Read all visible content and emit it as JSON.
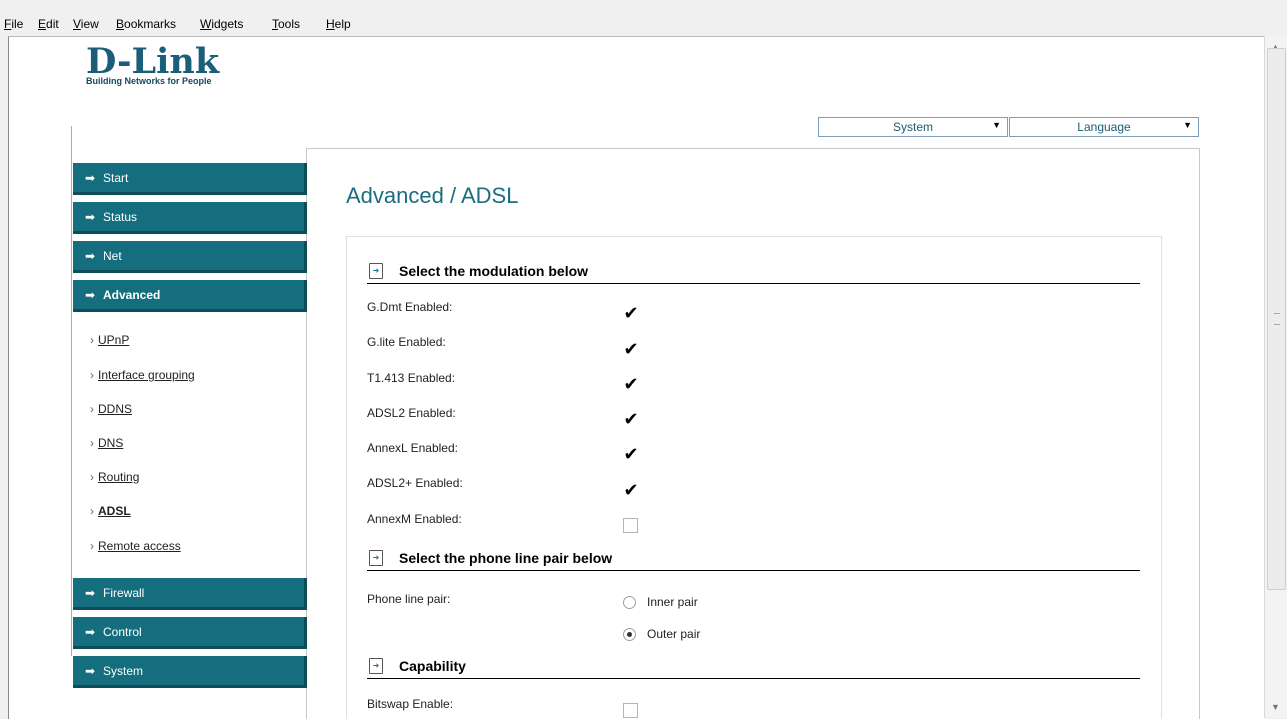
{
  "menubar": {
    "items": [
      {
        "first": "F",
        "rest": "ile"
      },
      {
        "first": "E",
        "rest": "dit"
      },
      {
        "first": "V",
        "rest": "iew"
      },
      {
        "first": "B",
        "rest": "ookmarks"
      },
      {
        "first": "W",
        "rest": "idgets"
      },
      {
        "first": "T",
        "rest": "ools"
      },
      {
        "first": "H",
        "rest": "elp"
      }
    ]
  },
  "header": {
    "logo": "D-Link",
    "tagline": "Building Networks for People",
    "system_select": "System",
    "language_select": "Language"
  },
  "sidebar": {
    "nav": [
      {
        "label": "Start"
      },
      {
        "label": "Status"
      },
      {
        "label": "Net"
      },
      {
        "label": "Advanced"
      },
      {
        "label": "Firewall"
      },
      {
        "label": "Control"
      },
      {
        "label": "System"
      }
    ],
    "arrow": "➡",
    "sub_marker": "›",
    "subitems": [
      {
        "label": "UPnP"
      },
      {
        "label": "Interface grouping"
      },
      {
        "label": "DDNS"
      },
      {
        "label": "DNS"
      },
      {
        "label": "Routing"
      },
      {
        "label": "ADSL"
      },
      {
        "label": "Remote access"
      }
    ]
  },
  "main": {
    "title": "Advanced / ADSL",
    "sections": {
      "modulation": "Select the modulation below",
      "phone_line": "Select the phone line pair below",
      "capability": "Capability"
    },
    "modulation": [
      {
        "label": "G.Dmt Enabled:",
        "checked": true
      },
      {
        "label": "G.lite Enabled:",
        "checked": true
      },
      {
        "label": "T1.413 Enabled:",
        "checked": true
      },
      {
        "label": "ADSL2 Enabled:",
        "checked": true
      },
      {
        "label": "AnnexL Enabled:",
        "checked": true
      },
      {
        "label": "ADSL2+ Enabled:",
        "checked": true
      },
      {
        "label": "AnnexM Enabled:",
        "checked": false
      }
    ],
    "phone_line_label": "Phone line pair:",
    "phone_line_options": [
      {
        "label": "Inner pair",
        "selected": false
      },
      {
        "label": "Outer pair",
        "selected": true
      }
    ],
    "capability": [
      {
        "label": "Bitswap Enable:",
        "checked": false
      }
    ],
    "check_glyph": "✔"
  }
}
